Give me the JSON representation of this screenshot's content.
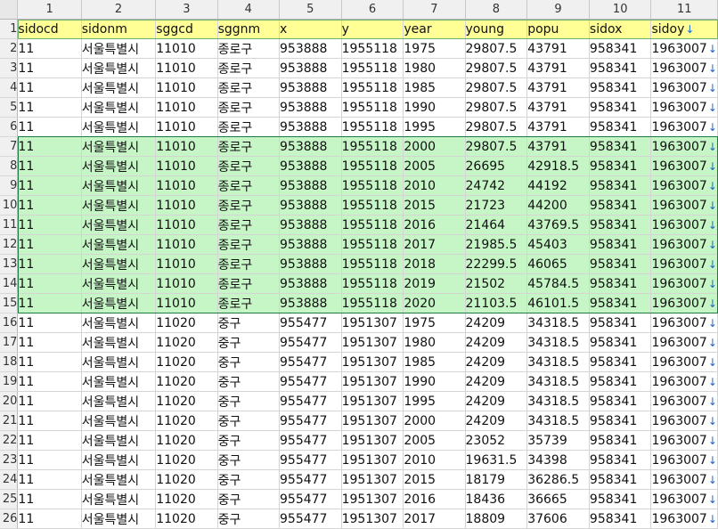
{
  "columns": [
    "1",
    "2",
    "3",
    "4",
    "5",
    "6",
    "7",
    "8",
    "9",
    "10",
    "11"
  ],
  "header": {
    "row": "1",
    "cells": [
      "sidocd",
      "sidonm",
      "sggcd",
      "sggnm",
      "x",
      "y",
      "year",
      "young",
      "popu",
      "sidox",
      "sidoy"
    ]
  },
  "rows": [
    {
      "n": "2",
      "cells": [
        "11",
        "서울특별시",
        "11010",
        "종로구",
        "953888",
        "1955118",
        "1975",
        "29807.5",
        "43791",
        "958341",
        "1963007"
      ]
    },
    {
      "n": "3",
      "cells": [
        "11",
        "서울특별시",
        "11010",
        "종로구",
        "953888",
        "1955118",
        "1980",
        "29807.5",
        "43791",
        "958341",
        "1963007"
      ]
    },
    {
      "n": "4",
      "cells": [
        "11",
        "서울특별시",
        "11010",
        "종로구",
        "953888",
        "1955118",
        "1985",
        "29807.5",
        "43791",
        "958341",
        "1963007"
      ]
    },
    {
      "n": "5",
      "cells": [
        "11",
        "서울특별시",
        "11010",
        "종로구",
        "953888",
        "1955118",
        "1990",
        "29807.5",
        "43791",
        "958341",
        "1963007"
      ]
    },
    {
      "n": "6",
      "cells": [
        "11",
        "서울특별시",
        "11010",
        "종로구",
        "953888",
        "1955118",
        "1995",
        "29807.5",
        "43791",
        "958341",
        "1963007"
      ]
    },
    {
      "n": "7",
      "cells": [
        "11",
        "서울특별시",
        "11010",
        "종로구",
        "953888",
        "1955118",
        "2000",
        "29807.5",
        "43791",
        "958341",
        "1963007"
      ]
    },
    {
      "n": "8",
      "cells": [
        "11",
        "서울특별시",
        "11010",
        "종로구",
        "953888",
        "1955118",
        "2005",
        "26695",
        "42918.5",
        "958341",
        "1963007"
      ]
    },
    {
      "n": "9",
      "cells": [
        "11",
        "서울특별시",
        "11010",
        "종로구",
        "953888",
        "1955118",
        "2010",
        "24742",
        "44192",
        "958341",
        "1963007"
      ]
    },
    {
      "n": "10",
      "cells": [
        "11",
        "서울특별시",
        "11010",
        "종로구",
        "953888",
        "1955118",
        "2015",
        "21723",
        "44200",
        "958341",
        "1963007"
      ]
    },
    {
      "n": "11",
      "cells": [
        "11",
        "서울특별시",
        "11010",
        "종로구",
        "953888",
        "1955118",
        "2016",
        "21464",
        "43769.5",
        "958341",
        "1963007"
      ]
    },
    {
      "n": "12",
      "cells": [
        "11",
        "서울특별시",
        "11010",
        "종로구",
        "953888",
        "1955118",
        "2017",
        "21985.5",
        "45403",
        "958341",
        "1963007"
      ]
    },
    {
      "n": "13",
      "cells": [
        "11",
        "서울특별시",
        "11010",
        "종로구",
        "953888",
        "1955118",
        "2018",
        "22299.5",
        "46065",
        "958341",
        "1963007"
      ]
    },
    {
      "n": "14",
      "cells": [
        "11",
        "서울특별시",
        "11010",
        "종로구",
        "953888",
        "1955118",
        "2019",
        "21502",
        "45784.5",
        "958341",
        "1963007"
      ]
    },
    {
      "n": "15",
      "cells": [
        "11",
        "서울특별시",
        "11010",
        "종로구",
        "953888",
        "1955118",
        "2020",
        "21103.5",
        "46101.5",
        "958341",
        "1963007"
      ]
    },
    {
      "n": "16",
      "cells": [
        "11",
        "서울특별시",
        "11020",
        "중구",
        "955477",
        "1951307",
        "1975",
        "24209",
        "34318.5",
        "958341",
        "1963007"
      ]
    },
    {
      "n": "17",
      "cells": [
        "11",
        "서울특별시",
        "11020",
        "중구",
        "955477",
        "1951307",
        "1980",
        "24209",
        "34318.5",
        "958341",
        "1963007"
      ]
    },
    {
      "n": "18",
      "cells": [
        "11",
        "서울특별시",
        "11020",
        "중구",
        "955477",
        "1951307",
        "1985",
        "24209",
        "34318.5",
        "958341",
        "1963007"
      ]
    },
    {
      "n": "19",
      "cells": [
        "11",
        "서울특별시",
        "11020",
        "중구",
        "955477",
        "1951307",
        "1990",
        "24209",
        "34318.5",
        "958341",
        "1963007"
      ]
    },
    {
      "n": "20",
      "cells": [
        "11",
        "서울특별시",
        "11020",
        "중구",
        "955477",
        "1951307",
        "1995",
        "24209",
        "34318.5",
        "958341",
        "1963007"
      ]
    },
    {
      "n": "21",
      "cells": [
        "11",
        "서울특별시",
        "11020",
        "중구",
        "955477",
        "1951307",
        "2000",
        "24209",
        "34318.5",
        "958341",
        "1963007"
      ]
    },
    {
      "n": "22",
      "cells": [
        "11",
        "서울특별시",
        "11020",
        "중구",
        "955477",
        "1951307",
        "2005",
        "23052",
        "35739",
        "958341",
        "1963007"
      ]
    },
    {
      "n": "23",
      "cells": [
        "11",
        "서울특별시",
        "11020",
        "중구",
        "955477",
        "1951307",
        "2010",
        "19631.5",
        "34398",
        "958341",
        "1963007"
      ]
    },
    {
      "n": "24",
      "cells": [
        "11",
        "서울특별시",
        "11020",
        "중구",
        "955477",
        "1951307",
        "2015",
        "18179",
        "36286.5",
        "958341",
        "1963007"
      ]
    },
    {
      "n": "25",
      "cells": [
        "11",
        "서울특별시",
        "11020",
        "중구",
        "955477",
        "1951307",
        "2016",
        "18436",
        "36665",
        "958341",
        "1963007"
      ]
    },
    {
      "n": "26",
      "cells": [
        "11",
        "서울특별시",
        "11020",
        "중구",
        "955477",
        "1951307",
        "2017",
        "18809",
        "37606",
        "958341",
        "1963007"
      ]
    }
  ],
  "selection": {
    "first_row": "7",
    "last_row": "15"
  },
  "colors": {
    "header_fill": "#ffff96",
    "selection_fill": "#c6f5c6",
    "selection_border": "#1e7a43",
    "overflow_arrow": "#1a66cc"
  },
  "icons": {
    "overflow": "arrow-down-icon"
  }
}
